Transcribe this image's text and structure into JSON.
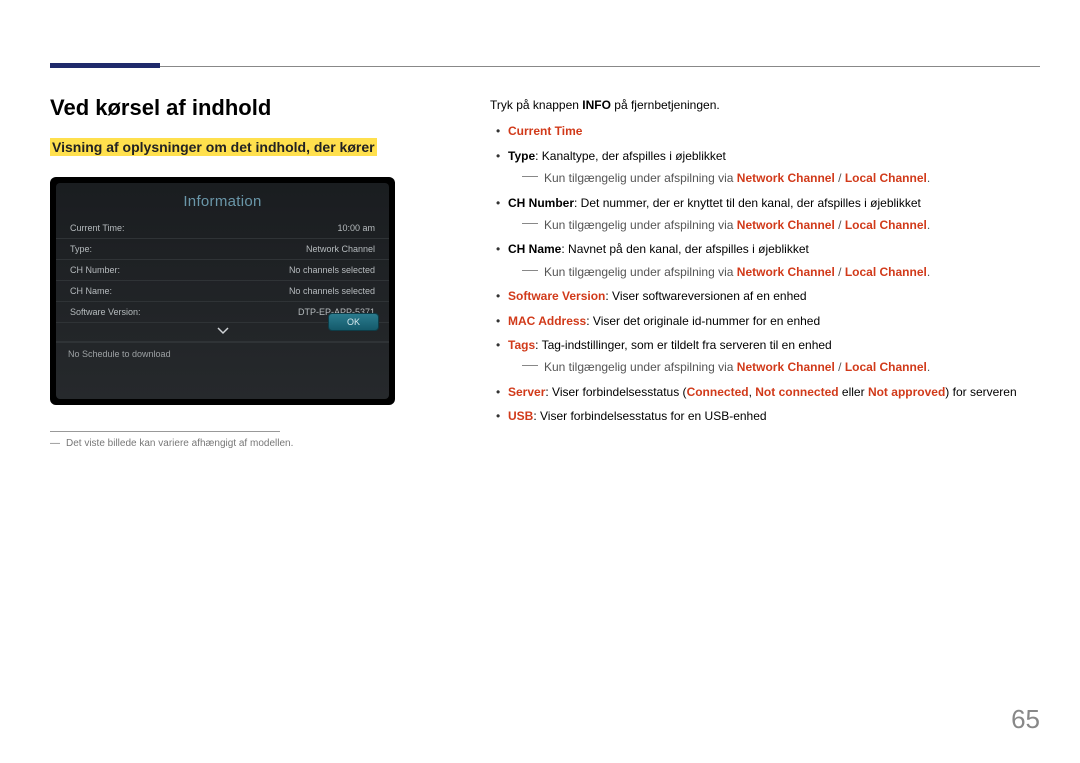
{
  "heading": "Ved kørsel af indhold",
  "subheading": "Visning af oplysninger om det indhold, der kører",
  "panel": {
    "title": "Information",
    "rows": [
      {
        "label": "Current Time:",
        "value": "10:00 am"
      },
      {
        "label": "Type:",
        "value": "Network Channel"
      },
      {
        "label": "CH Number:",
        "value": "No channels selected"
      },
      {
        "label": "CH Name:",
        "value": "No channels selected"
      },
      {
        "label": "Software Version:",
        "value": "DTP-EP-APP-5371"
      }
    ],
    "schedule": "No Schedule to download",
    "ok": "OK"
  },
  "footnote_dash": "―",
  "footnote": "Det viste billede kan variere afhængigt af modellen.",
  "intro_pre": "Tryk på knappen ",
  "intro_bold": "INFO",
  "intro_post": " på fjernbetjeningen.",
  "avail_pre": "Kun tilgængelig under afspilning via ",
  "avail_nc": "Network Channel",
  "avail_sep": " / ",
  "avail_lc": "Local Channel",
  "avail_period": ".",
  "items": {
    "current_time": "Current Time",
    "type_bold": "Type",
    "type_rest": ": Kanaltype, der afspilles i øjeblikket",
    "ch_number_bold": "CH Number",
    "ch_number_rest": ": Det nummer, der er knyttet til den kanal, der afspilles i øjeblikket",
    "ch_name_bold": "CH Name",
    "ch_name_rest": ": Navnet på den kanal, der afspilles i øjeblikket",
    "sw_bold": "Software Version",
    "sw_rest": ": Viser softwareversionen af en enhed",
    "mac_bold": "MAC Address",
    "mac_rest": ": Viser det originale id-nummer for en enhed",
    "tags_bold": "Tags",
    "tags_rest": ": Tag-indstillinger, som er tildelt fra serveren til en enhed",
    "server_bold": "Server",
    "server_pre": ": Viser forbindelsesstatus (",
    "server_c": "Connected",
    "server_comma": ", ",
    "server_nc": "Not connected",
    "server_or": " eller ",
    "server_na": "Not approved",
    "server_post": ") for serveren",
    "usb_bold": "USB",
    "usb_rest": ": Viser forbindelsesstatus for en USB-enhed"
  },
  "page": "65"
}
